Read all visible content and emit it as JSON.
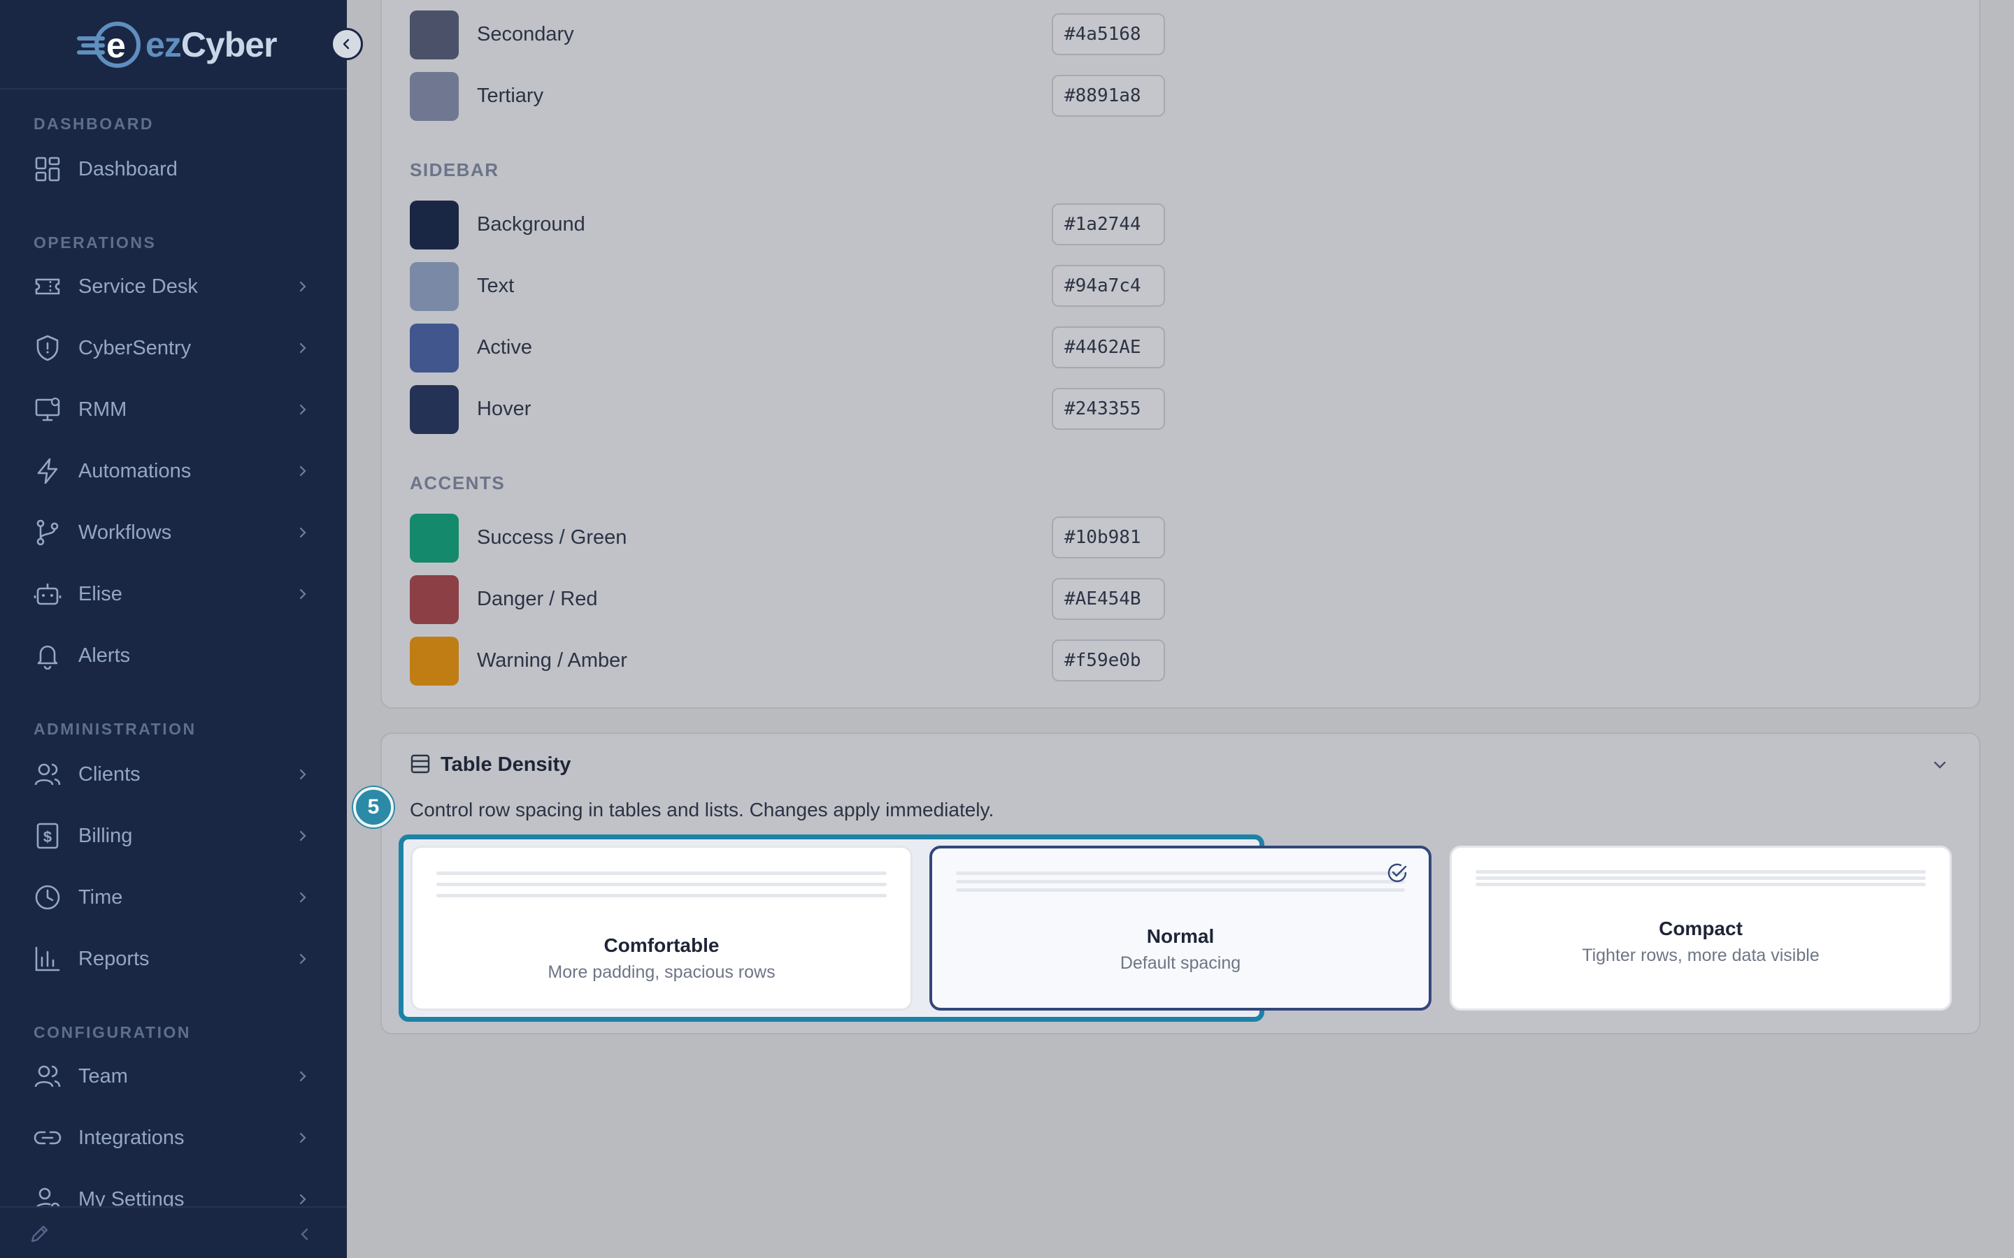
{
  "brand": {
    "logo_e": "e",
    "logo_ez": "ez",
    "logo_cyber": "Cyber"
  },
  "sidebar": {
    "sections": {
      "dashboard": "DASHBOARD",
      "operations": "OPERATIONS",
      "administration": "ADMINISTRATION",
      "configuration": "CONFIGURATION"
    },
    "items": [
      {
        "label": "Dashboard",
        "icon": "grid-icon"
      },
      {
        "label": "Service Desk",
        "icon": "ticket-icon"
      },
      {
        "label": "CyberSentry",
        "icon": "shield-icon"
      },
      {
        "label": "RMM",
        "icon": "monitor-icon"
      },
      {
        "label": "Automations",
        "icon": "lightning-icon"
      },
      {
        "label": "Workflows",
        "icon": "branch-icon"
      },
      {
        "label": "Elise",
        "icon": "robot-icon"
      },
      {
        "label": "Alerts",
        "icon": "bell-icon"
      },
      {
        "label": "Clients",
        "icon": "users-icon"
      },
      {
        "label": "Billing",
        "icon": "dollar-icon"
      },
      {
        "label": "Time",
        "icon": "clock-icon"
      },
      {
        "label": "Reports",
        "icon": "bar-chart-icon"
      },
      {
        "label": "Team",
        "icon": "users-icon"
      },
      {
        "label": "Integrations",
        "icon": "link-icon"
      },
      {
        "label": "My Settings",
        "icon": "user-gear-icon"
      }
    ]
  },
  "colors": {
    "text_group": [
      {
        "label": "Secondary",
        "hex": "#4a5168",
        "color": "#4a5168"
      },
      {
        "label": "Tertiary",
        "hex": "#8891a8",
        "color": "#707891"
      }
    ],
    "sidebar_group_label": "SIDEBAR",
    "sidebar_group": [
      {
        "label": "Background",
        "hex": "#1a2744",
        "color": "#1a2744"
      },
      {
        "label": "Text",
        "hex": "#94a7c4",
        "color": "#7a8aa6"
      },
      {
        "label": "Active",
        "hex": "#4462AE",
        "color": "#41568d"
      },
      {
        "label": "Hover",
        "hex": "#243355",
        "color": "#243355"
      }
    ],
    "accents_group_label": "ACCENTS",
    "accents_group": [
      {
        "label": "Success / Green",
        "hex": "#10b981",
        "color": "#15896b"
      },
      {
        "label": "Danger / Red",
        "hex": "#AE454B",
        "color": "#8c3f45"
      },
      {
        "label": "Warning / Amber",
        "hex": "#f59e0b",
        "color": "#c07d14"
      }
    ]
  },
  "density": {
    "title": "Table Density",
    "description": "Control row spacing in tables and lists. Changes apply immediately.",
    "step_badge": "5",
    "options": [
      {
        "name": "Comfortable",
        "sub": "More padding, spacious rows",
        "selected": false
      },
      {
        "name": "Normal",
        "sub": "Default spacing",
        "selected": true
      },
      {
        "name": "Compact",
        "sub": "Tighter rows, more data visible",
        "selected": false
      }
    ]
  }
}
